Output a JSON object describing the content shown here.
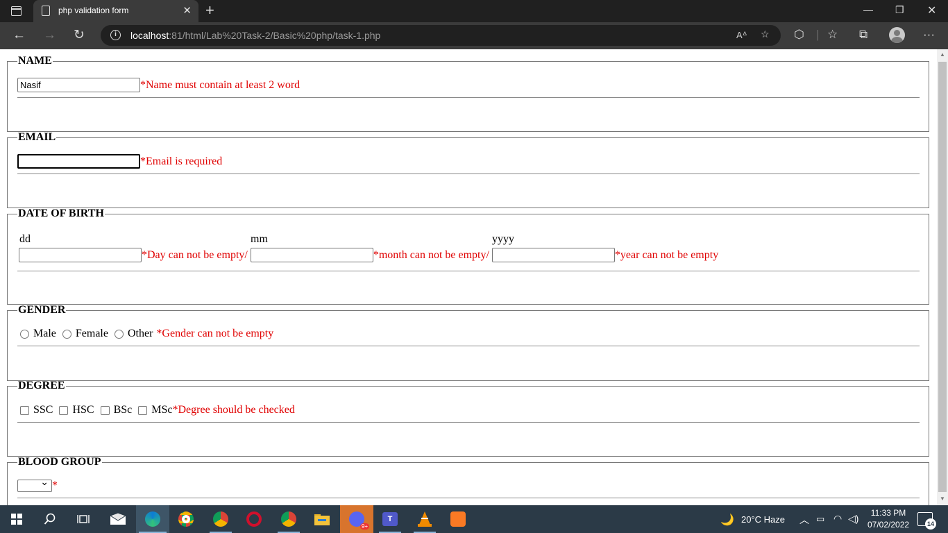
{
  "browser": {
    "tab_title": "php validation form",
    "url_host": "localhost",
    "url_rest": ":81/html/Lab%20Task-2/Basic%20php/task-1.php"
  },
  "form": {
    "name": {
      "legend": "NAME",
      "value": "Nasif",
      "error": "*Name must contain at least 2 word"
    },
    "email": {
      "legend": "EMAIL",
      "value": "",
      "error": "*Email is required"
    },
    "dob": {
      "legend": "DATE OF BIRTH",
      "dd_label": "dd",
      "mm_label": "mm",
      "yyyy_label": "yyyy",
      "day_error": "*Day can not be empty/",
      "month_error": "*month can not be empty/",
      "year_error": "*year can not be empty"
    },
    "gender": {
      "legend": "GENDER",
      "options": [
        "Male",
        "Female",
        "Other"
      ],
      "error": "*Gender can not be empty"
    },
    "degree": {
      "legend": "DEGREE",
      "options": [
        "SSC",
        "HSC",
        "BSc",
        "MSc"
      ],
      "error": "*Degree should be checked"
    },
    "blood_group": {
      "legend": "BLOOD GROUP",
      "selected": "",
      "error": "*"
    }
  },
  "taskbar": {
    "weather": "20°C  Haze",
    "time": "11:33 PM",
    "date": "07/02/2022",
    "notifications": "14",
    "discord_badge": "9+"
  },
  "colors": {
    "error": "#e00000",
    "chrome_dark": "#202020",
    "toolbar": "#3b3b3b",
    "taskbar": "#2b3a47"
  }
}
